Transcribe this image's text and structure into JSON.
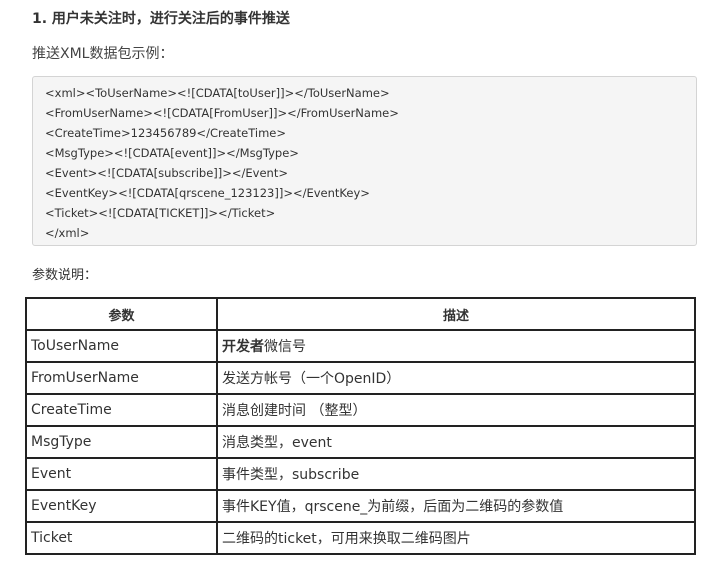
{
  "heading": "1. 用户未关注时，进行关注后的事件推送",
  "intro": "推送XML数据包示例：",
  "code_lines": [
    "<xml><ToUserName><![CDATA[toUser]]></ToUserName>",
    "<FromUserName><![CDATA[FromUser]]></FromUserName>",
    "<CreateTime>123456789</CreateTime>",
    "<MsgType><![CDATA[event]]></MsgType>",
    "<Event><![CDATA[subscribe]]></Event>",
    "<EventKey><![CDATA[qrscene_123123]]></EventKey>",
    "<Ticket><![CDATA[TICKET]]></Ticket>",
    "</xml>"
  ],
  "params_label": "参数说明：",
  "table": {
    "headers": [
      "参数",
      "描述"
    ],
    "rows": [
      {
        "param": "ToUserName",
        "desc_bold": "开发者",
        "desc": "微信号"
      },
      {
        "param": "FromUserName",
        "desc_bold": "",
        "desc": "发送方帐号（一个OpenID）"
      },
      {
        "param": "CreateTime",
        "desc_bold": "",
        "desc": "消息创建时间 （整型）"
      },
      {
        "param": "MsgType",
        "desc_bold": "",
        "desc": "消息类型，event"
      },
      {
        "param": "Event",
        "desc_bold": "",
        "desc": "事件类型，subscribe"
      },
      {
        "param": "EventKey",
        "desc_bold": "",
        "desc": "事件KEY值，qrscene_为前缀，后面为二维码的参数值"
      },
      {
        "param": "Ticket",
        "desc_bold": "",
        "desc": "二维码的ticket，可用来换取二维码图片"
      }
    ]
  }
}
